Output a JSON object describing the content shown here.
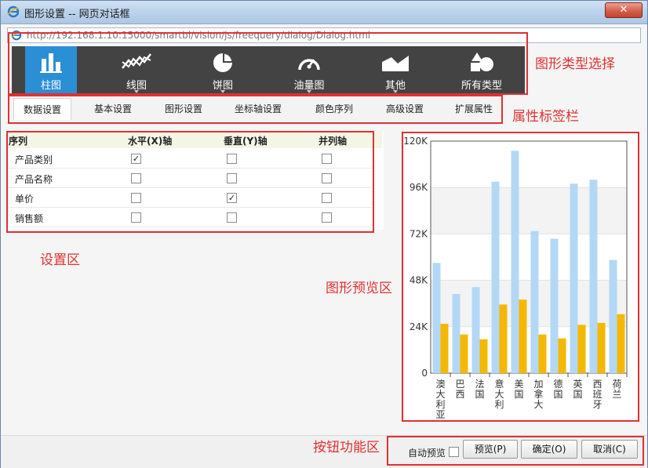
{
  "window": {
    "title": "图形设置 -- 网页对话框",
    "close_label": "✕",
    "url": "http://192.168.1.10:15000/smartbi/vision/js/freequery/dialog/Dialog.html"
  },
  "chart_types": [
    {
      "label": "柱图",
      "icon": "bar-chart-icon",
      "active": true
    },
    {
      "label": "线图",
      "icon": "line-chart-icon",
      "active": false
    },
    {
      "label": "饼图",
      "icon": "pie-chart-icon",
      "active": false
    },
    {
      "label": "油量图",
      "icon": "gauge-icon",
      "active": false
    },
    {
      "label": "其他",
      "icon": "area-chart-icon",
      "active": false
    },
    {
      "label": "所有类型",
      "icon": "all-types-icon",
      "active": false
    }
  ],
  "tabs": [
    {
      "label": "数据设置",
      "active": true
    },
    {
      "label": "基本设置",
      "active": false
    },
    {
      "label": "图形设置",
      "active": false
    },
    {
      "label": "坐标轴设置",
      "active": false
    },
    {
      "label": "颜色序列",
      "active": false
    },
    {
      "label": "高级设置",
      "active": false
    },
    {
      "label": "扩展属性",
      "active": false
    }
  ],
  "settings": {
    "columns": [
      "序列",
      "水平(X)轴",
      "垂直(Y)轴",
      "并列轴"
    ],
    "rows": [
      {
        "label": "产品类别",
        "x": true,
        "y": false,
        "parallel": false
      },
      {
        "label": "产品名称",
        "x": false,
        "y": false,
        "parallel": false
      },
      {
        "label": "单价",
        "x": false,
        "y": true,
        "parallel": false
      },
      {
        "label": "销售额",
        "x": false,
        "y": false,
        "parallel": false
      }
    ]
  },
  "annotations": {
    "chart_type_select": "图形类型选择",
    "property_tabs": "属性标签栏",
    "settings_area": "设置区",
    "preview_area": "图形预览区",
    "button_area": "按钮功能区"
  },
  "footer": {
    "auto_preview_label": "自动预览",
    "auto_preview_checked": false,
    "preview_button": "预览(P)",
    "ok_button": "确定(O)",
    "cancel_button": "取消(C)"
  },
  "chart_data": {
    "type": "bar",
    "categories": [
      "澳大利亚",
      "巴西",
      "法国",
      "意大利",
      "美国",
      "加拿大",
      "德国",
      "英国",
      "西班牙",
      "荷兰"
    ],
    "series": [
      {
        "values": [
          57000,
          41000,
          44500,
          99000,
          115000,
          73500,
          69500,
          98000,
          100000,
          58500
        ],
        "color": "#b3d8f5"
      },
      {
        "values": [
          25500,
          20000,
          17500,
          35500,
          38000,
          20000,
          18000,
          25000,
          26000,
          30500
        ],
        "color": "#f5b800"
      }
    ],
    "ylim": [
      0,
      120000
    ],
    "yticks": [
      "0",
      "24K",
      "48K",
      "72K",
      "96K",
      "120K"
    ],
    "grid": true
  }
}
